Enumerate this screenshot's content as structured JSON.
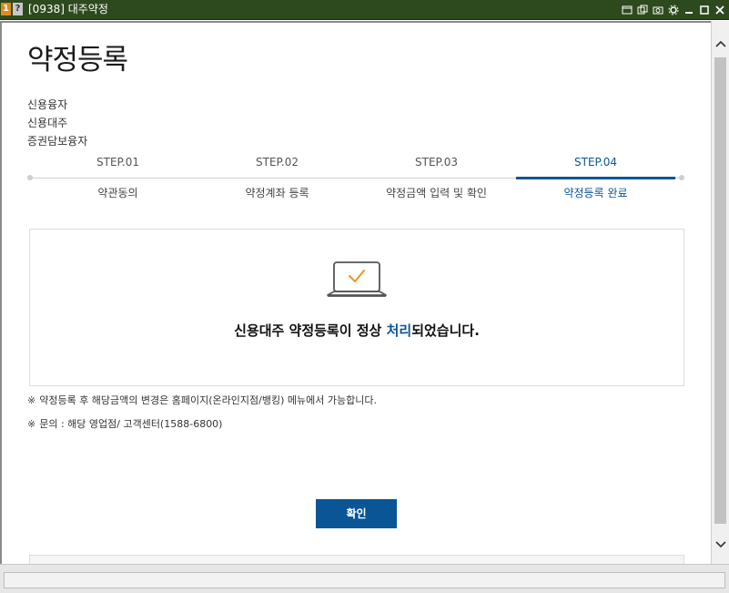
{
  "window": {
    "badge_number": "1",
    "badge_help": "?",
    "title": "[0938] 대주약정",
    "icons": [
      "window-icon",
      "copy-icon",
      "camera-icon",
      "gear-icon",
      "minimize-icon",
      "maximize-icon",
      "close-icon"
    ]
  },
  "page": {
    "title": "약정등록",
    "products": [
      "신용융자",
      "신용대주",
      "증권담보융자"
    ]
  },
  "steps": [
    {
      "num": "STEP.01",
      "label": "약관동의",
      "active": false
    },
    {
      "num": "STEP.02",
      "label": "약정계좌 등록",
      "active": false
    },
    {
      "num": "STEP.03",
      "label": "약정금액 입력 및 확인",
      "active": false
    },
    {
      "num": "STEP.04",
      "label": "약정등록 완료",
      "active": true
    }
  ],
  "result": {
    "icon": "laptop-check-icon",
    "message_prefix": "신용대주 약정등록이 정상 ",
    "message_highlight": "처리",
    "message_suffix": "되었습니다."
  },
  "notes": [
    {
      "mark": "※",
      "text": "약정등록 후 해당금액의 변경은 홈페이지(온라인지점/뱅킹) 메뉴에서 가능합니다."
    },
    {
      "mark": "※",
      "text": "문의 : 해당 영업점/ 고객센터(1588-6800)"
    }
  ],
  "actions": {
    "confirm_label": "확인"
  },
  "colors": {
    "titlebar": "#2d4a1e",
    "accent": "#0a5595",
    "check": "#e8962a"
  }
}
